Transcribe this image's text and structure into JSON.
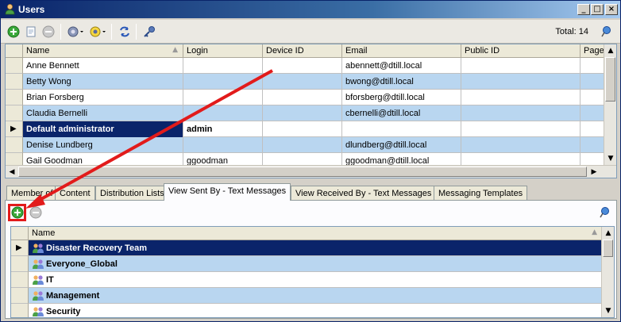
{
  "window": {
    "title": "Users"
  },
  "toolbar": {
    "total_label": "Total: 14"
  },
  "grid": {
    "columns": [
      "Name",
      "Login",
      "Device ID",
      "Email",
      "Public ID",
      "Page"
    ],
    "rows": [
      {
        "name": "Anne Bennett",
        "login": "",
        "device": "",
        "email": "abennett@dtill.local",
        "public": ""
      },
      {
        "name": "Betty Wong",
        "login": "",
        "device": "",
        "email": "bwong@dtill.local",
        "public": ""
      },
      {
        "name": "Brian Forsberg",
        "login": "",
        "device": "",
        "email": "bforsberg@dtill.local",
        "public": ""
      },
      {
        "name": "Claudia Bernelli",
        "login": "",
        "device": "",
        "email": "cbernelli@dtill.local",
        "public": ""
      },
      {
        "name": "Default administrator",
        "login": "admin",
        "device": "",
        "email": "",
        "public": ""
      },
      {
        "name": "Denise Lundberg",
        "login": "",
        "device": "",
        "email": "dlundberg@dtill.local",
        "public": ""
      },
      {
        "name": "Gail Goodman",
        "login": "ggoodman",
        "device": "",
        "email": "ggoodman@dtill.local",
        "public": ""
      }
    ]
  },
  "tabs": [
    "Member of",
    "Content",
    "Distribution Lists",
    "View Sent By - Text Messages",
    "View Received By - Text Messages",
    "Messaging Templates"
  ],
  "subgrid": {
    "column": "Name",
    "rows": [
      "Disaster Recovery Team",
      "Everyone_Global",
      "IT",
      "Management",
      "Security"
    ]
  },
  "colors": {
    "selection": "#0a246a",
    "alt_row": "#b9d6f0",
    "annotation": "#e21b1b"
  }
}
